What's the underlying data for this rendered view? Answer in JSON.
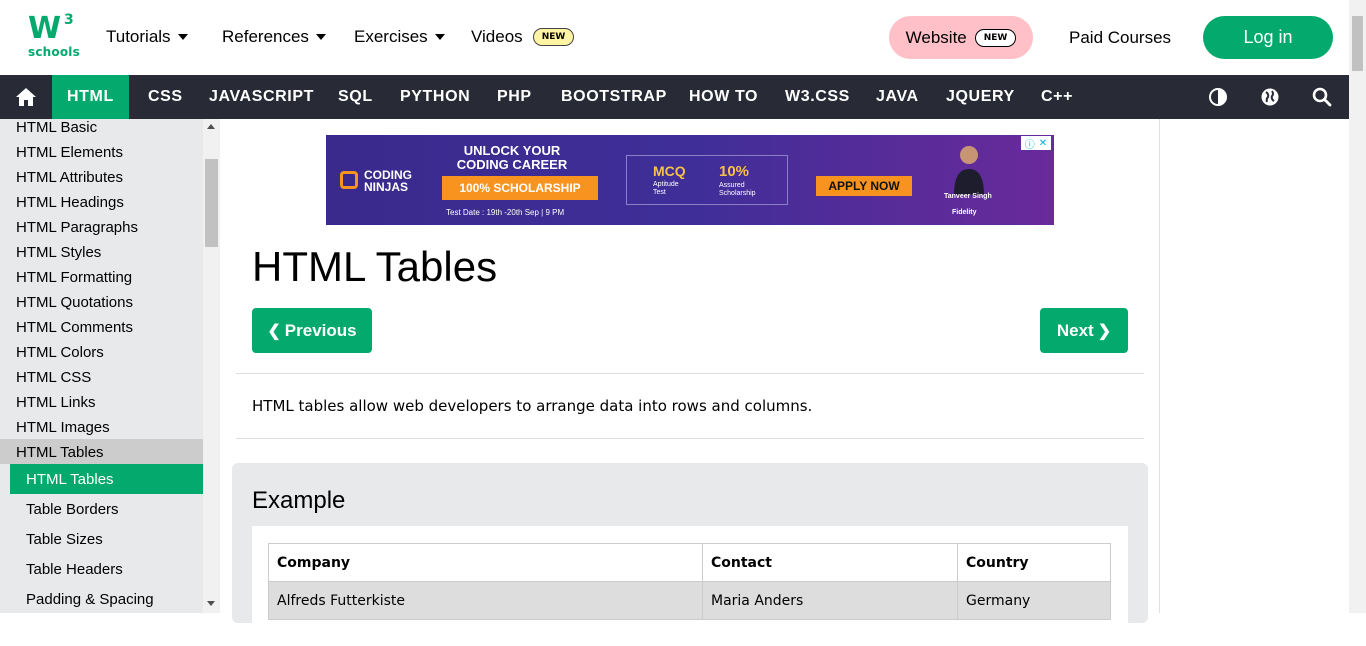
{
  "header": {
    "logo_mark": "W",
    "logo_superscript": "3",
    "logo_text": "schools",
    "nav": [
      {
        "label": "Tutorials"
      },
      {
        "label": "References"
      },
      {
        "label": "Exercises"
      },
      {
        "label": "Videos",
        "badge": "NEW"
      }
    ],
    "website_label": "Website",
    "website_badge": "NEW",
    "paid_courses": "Paid Courses",
    "login": "Log in"
  },
  "topics": {
    "active": "HTML",
    "items": [
      "CSS",
      "JAVASCRIPT",
      "SQL",
      "PYTHON",
      "PHP",
      "BOOTSTRAP",
      "HOW TO",
      "W3.CSS",
      "JAVA",
      "JQUERY",
      "C++"
    ]
  },
  "sidebar": {
    "links": [
      "HTML Basic",
      "HTML Elements",
      "HTML Attributes",
      "HTML Headings",
      "HTML Paragraphs",
      "HTML Styles",
      "HTML Formatting",
      "HTML Quotations",
      "HTML Comments",
      "HTML Colors",
      "HTML CSS",
      "HTML Links",
      "HTML Images"
    ],
    "section": "HTML Tables",
    "sub_active": "HTML Tables",
    "sub_links": [
      "Table Borders",
      "Table Sizes",
      "Table Headers",
      "Padding & Spacing"
    ]
  },
  "ad": {
    "brand_line1": "CODING",
    "brand_line2": "NINJAS",
    "headline_1": "UNLOCK YOUR",
    "headline_2": "CODING CAREER",
    "scholarship": "100% SCHOLARSHIP",
    "date": "Test Date : 19th -20th Sep | 9 PM",
    "mcq": "MCQ",
    "mcq_sub_1": "Aptitude",
    "mcq_sub_2": "Test",
    "pct": "10%",
    "pct_sub_1": "Assured",
    "pct_sub_2": "Scholarship",
    "apply": "APPLY NOW",
    "person": "Tanveer Singh",
    "sponsor": "Fidelity"
  },
  "main": {
    "title": "HTML Tables",
    "prev": "Previous",
    "next": "Next",
    "intro": "HTML tables allow web developers to arrange data into rows and columns.",
    "example_heading": "Example",
    "table": {
      "headers": [
        "Company",
        "Contact",
        "Country"
      ],
      "rows": [
        [
          "Alfreds Futterkiste",
          "Maria Anders",
          "Germany"
        ]
      ]
    }
  },
  "colors": {
    "brand_green": "#04AA6D",
    "dark_nav": "#282A35",
    "sidebar_bg": "#E7E9EB",
    "website_pink": "#FFC0C7"
  }
}
